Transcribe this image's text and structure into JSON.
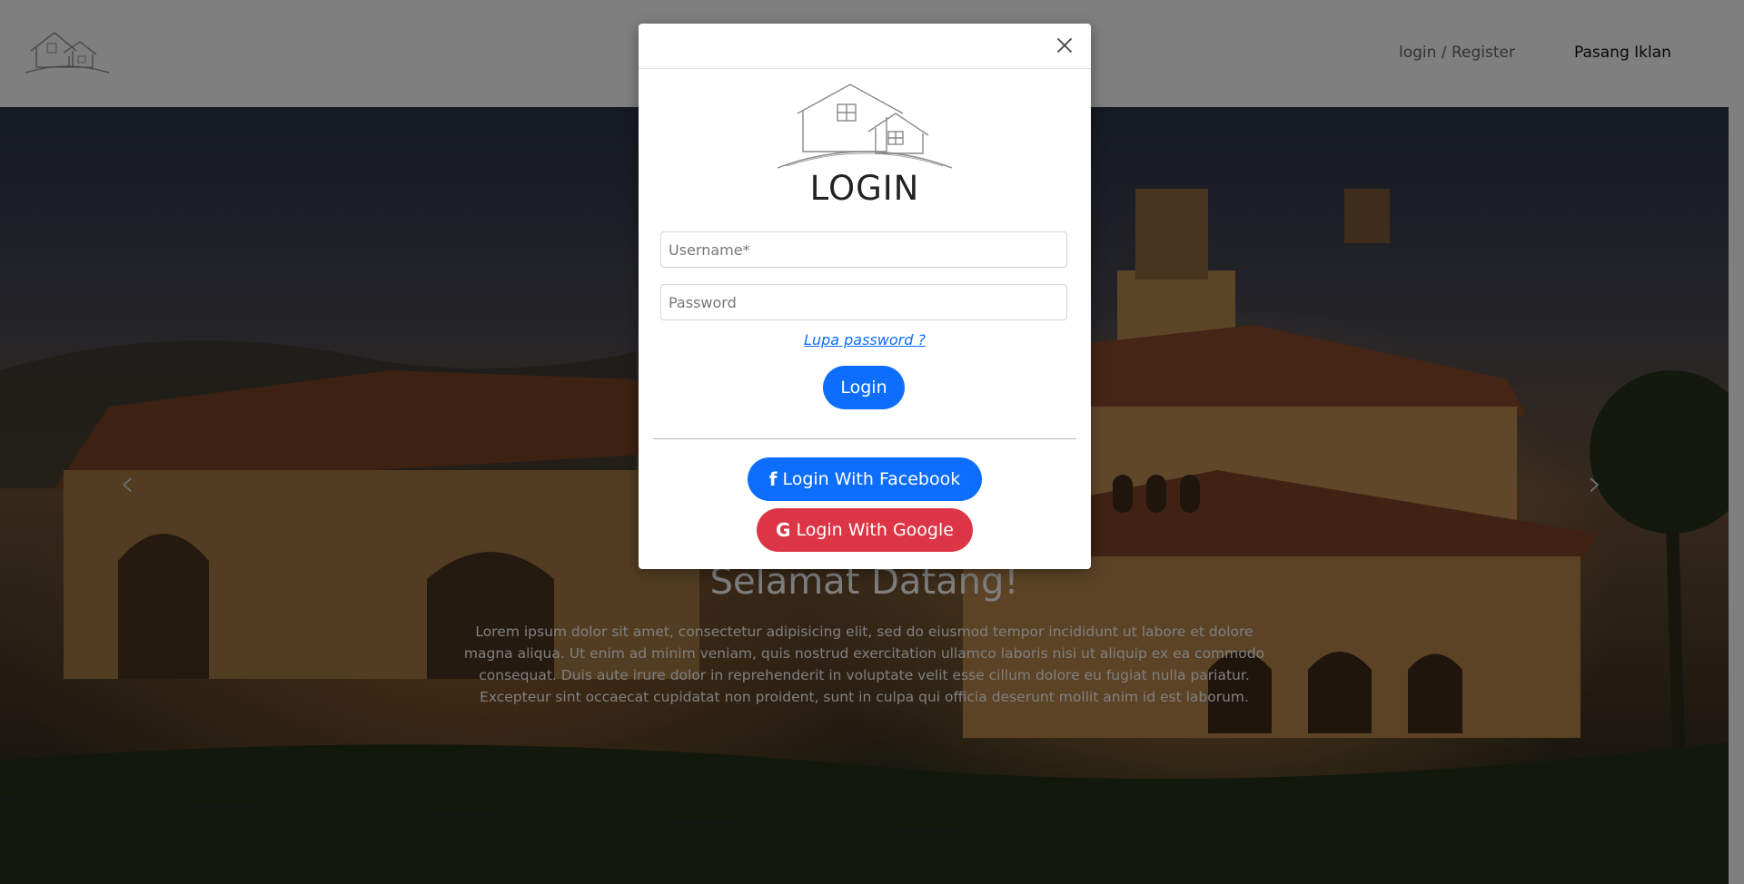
{
  "header": {
    "nav_login_register": "login / Register",
    "nav_pasang_iklan": "Pasang Iklan"
  },
  "hero": {
    "title": "Selamat Datang!",
    "text": "Lorem ipsum dolor sit amet, consectetur adipisicing elit, sed do eiusmod tempor incididunt ut labore et dolore magna aliqua. Ut enim ad minim veniam, quis nostrud exercitation ullamco laboris nisi ut aliquip ex ea commodo consequat. Duis aute irure dolor in reprehenderit in voluptate velit esse cillum dolore eu fugiat nulla pariatur. Excepteur sint occaecat cupidatat non proident, sunt in culpa qui officia deserunt mollit anim id est laborum.",
    "prev_arrow": "‹",
    "next_arrow": "›"
  },
  "modal": {
    "title": "LOGIN",
    "username_placeholder": "Username*",
    "password_placeholder": "Password",
    "forgot_password": "Lupa password ?",
    "login_button": "Login",
    "facebook_button": "Login With Facebook",
    "google_button": "Login With Google",
    "facebook_icon": "f",
    "google_icon": "G"
  },
  "colors": {
    "primary": "#0d6efd",
    "danger": "#dc3545",
    "backdrop": "rgba(0,0,0,0.5)"
  },
  "icons": {
    "close": "close-icon",
    "logo": "house-logo-icon",
    "facebook": "facebook-icon",
    "google": "google-icon"
  }
}
